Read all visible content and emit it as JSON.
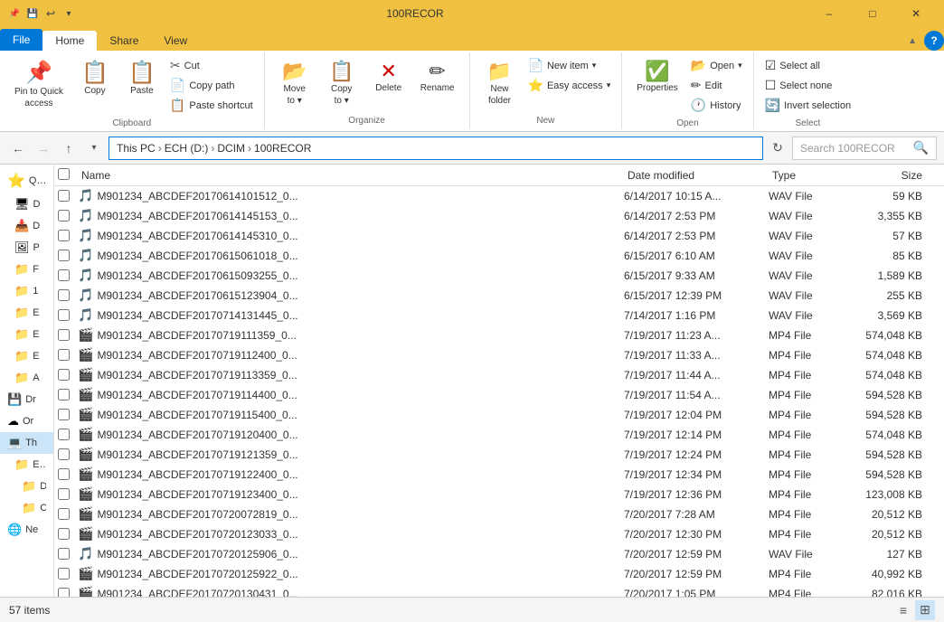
{
  "titleBar": {
    "title": "100RECOR",
    "pinIcon": "📌",
    "quickAccessIcons": [
      "💾",
      "↩️",
      "⚡"
    ],
    "minimizeLabel": "–",
    "maximizeLabel": "□",
    "closeLabel": "✕"
  },
  "ribbon": {
    "tabs": [
      "File",
      "Home",
      "Share",
      "View"
    ],
    "activeTab": "Home",
    "sections": {
      "clipboard": {
        "label": "Clipboard",
        "pinBtn": "📌",
        "pinLabel": "Pin to Quick\naccess",
        "copyBtn": "Copy",
        "pasteBtn": "Paste",
        "cutLabel": "Cut",
        "copyPathLabel": "Copy path",
        "pasteShortcutLabel": "Paste shortcut"
      },
      "organize": {
        "label": "Organize",
        "moveToLabel": "Move\nto",
        "copyToLabel": "Copy\nto",
        "deleteLabel": "Delete",
        "renameLabel": "Rename"
      },
      "new": {
        "label": "New",
        "newFolderLabel": "New\nfolder",
        "newItemLabel": "New item",
        "easyAccessLabel": "Easy access"
      },
      "open": {
        "label": "Open",
        "openLabel": "Open",
        "editLabel": "Edit",
        "historyLabel": "History",
        "propertiesLabel": "Properties"
      },
      "select": {
        "label": "Select",
        "selectAllLabel": "Select all",
        "selectNoneLabel": "Select none",
        "invertLabel": "Invert selection"
      }
    }
  },
  "addressBar": {
    "backDisabled": false,
    "forwardDisabled": true,
    "upLabel": "↑",
    "path": [
      "This PC",
      "ECH (D:)",
      "DCIM",
      "100RECOR"
    ],
    "searchPlaceholder": "Search 100RECOR",
    "refreshLabel": "↻"
  },
  "sidebar": {
    "items": [
      {
        "id": "quick-access",
        "icon": "⭐",
        "label": "Qu...",
        "selected": false
      },
      {
        "id": "desktop",
        "icon": "🖥",
        "label": "D",
        "selected": false
      },
      {
        "id": "downloads",
        "icon": "📥",
        "label": "D",
        "selected": false
      },
      {
        "id": "pictures",
        "icon": "🖼",
        "label": "P",
        "selected": false
      },
      {
        "id": "folder1",
        "icon": "📁",
        "label": "F",
        "selected": false
      },
      {
        "id": "folder2",
        "icon": "📁",
        "label": "1",
        "selected": false
      },
      {
        "id": "folder3",
        "icon": "📁",
        "label": "E",
        "selected": false
      },
      {
        "id": "folder4",
        "icon": "📁",
        "label": "E",
        "selected": false
      },
      {
        "id": "folder5",
        "icon": "📁",
        "label": "E",
        "selected": false
      },
      {
        "id": "folder6",
        "icon": "📁",
        "label": "A",
        "selected": false
      },
      {
        "id": "drives",
        "icon": "💾",
        "label": "Dr",
        "selected": false
      },
      {
        "id": "onedrive",
        "icon": "☁",
        "label": "Or",
        "selected": false
      },
      {
        "id": "thispc",
        "icon": "💻",
        "label": "Th",
        "selected": true
      },
      {
        "id": "ech",
        "icon": "📁",
        "label": "EC",
        "selected": false
      },
      {
        "id": "local1",
        "icon": "📁",
        "label": "D",
        "selected": false
      },
      {
        "id": "local2",
        "icon": "📁",
        "label": "C",
        "selected": false
      },
      {
        "id": "network",
        "icon": "🌐",
        "label": "Ne",
        "selected": false
      }
    ]
  },
  "fileList": {
    "headers": {
      "name": "Name",
      "dateModified": "Date modified",
      "type": "Type",
      "size": "Size"
    },
    "files": [
      {
        "name": "M901234_ABCDEF20170614101512_0...",
        "date": "6/14/2017 10:15 A...",
        "type": "WAV File",
        "size": "59 KB",
        "icon": "🎵"
      },
      {
        "name": "M901234_ABCDEF20170614145153_0...",
        "date": "6/14/2017 2:53 PM",
        "type": "WAV File",
        "size": "3,355 KB",
        "icon": "🎵"
      },
      {
        "name": "M901234_ABCDEF20170614145310_0...",
        "date": "6/14/2017 2:53 PM",
        "type": "WAV File",
        "size": "57 KB",
        "icon": "🎵"
      },
      {
        "name": "M901234_ABCDEF20170615061018_0...",
        "date": "6/15/2017 6:10 AM",
        "type": "WAV File",
        "size": "85 KB",
        "icon": "🎵"
      },
      {
        "name": "M901234_ABCDEF20170615093255_0...",
        "date": "6/15/2017 9:33 AM",
        "type": "WAV File",
        "size": "1,589 KB",
        "icon": "🎵"
      },
      {
        "name": "M901234_ABCDEF20170615123904_0...",
        "date": "6/15/2017 12:39 PM",
        "type": "WAV File",
        "size": "255 KB",
        "icon": "🎵"
      },
      {
        "name": "M901234_ABCDEF20170714131445_0...",
        "date": "7/14/2017 1:16 PM",
        "type": "WAV File",
        "size": "3,569 KB",
        "icon": "🎵"
      },
      {
        "name": "M901234_ABCDEF20170719111359_0...",
        "date": "7/19/2017 11:23 A...",
        "type": "MP4 File",
        "size": "574,048 KB",
        "icon": "🎬"
      },
      {
        "name": "M901234_ABCDEF20170719112400_0...",
        "date": "7/19/2017 11:33 A...",
        "type": "MP4 File",
        "size": "574,048 KB",
        "icon": "🎬"
      },
      {
        "name": "M901234_ABCDEF20170719113359_0...",
        "date": "7/19/2017 11:44 A...",
        "type": "MP4 File",
        "size": "574,048 KB",
        "icon": "🎬"
      },
      {
        "name": "M901234_ABCDEF20170719114400_0...",
        "date": "7/19/2017 11:54 A...",
        "type": "MP4 File",
        "size": "594,528 KB",
        "icon": "🎬"
      },
      {
        "name": "M901234_ABCDEF20170719115400_0...",
        "date": "7/19/2017 12:04 PM",
        "type": "MP4 File",
        "size": "594,528 KB",
        "icon": "🎬"
      },
      {
        "name": "M901234_ABCDEF20170719120400_0...",
        "date": "7/19/2017 12:14 PM",
        "type": "MP4 File",
        "size": "574,048 KB",
        "icon": "🎬"
      },
      {
        "name": "M901234_ABCDEF20170719121359_0...",
        "date": "7/19/2017 12:24 PM",
        "type": "MP4 File",
        "size": "594,528 KB",
        "icon": "🎬"
      },
      {
        "name": "M901234_ABCDEF20170719122400_0...",
        "date": "7/19/2017 12:34 PM",
        "type": "MP4 File",
        "size": "594,528 KB",
        "icon": "🎬"
      },
      {
        "name": "M901234_ABCDEF20170719123400_0...",
        "date": "7/19/2017 12:36 PM",
        "type": "MP4 File",
        "size": "123,008 KB",
        "icon": "🎬"
      },
      {
        "name": "M901234_ABCDEF20170720072819_0...",
        "date": "7/20/2017 7:28 AM",
        "type": "MP4 File",
        "size": "20,512 KB",
        "icon": "🎬"
      },
      {
        "name": "M901234_ABCDEF20170720123033_0...",
        "date": "7/20/2017 12:30 PM",
        "type": "MP4 File",
        "size": "20,512 KB",
        "icon": "🎬"
      },
      {
        "name": "M901234_ABCDEF20170720125906_0...",
        "date": "7/20/2017 12:59 PM",
        "type": "WAV File",
        "size": "127 KB",
        "icon": "🎵"
      },
      {
        "name": "M901234_ABCDEF20170720125922_0...",
        "date": "7/20/2017 12:59 PM",
        "type": "MP4 File",
        "size": "40,992 KB",
        "icon": "🎬"
      },
      {
        "name": "M901234_ABCDEF20170720130431_0...",
        "date": "7/20/2017 1:05 PM",
        "type": "MP4 File",
        "size": "82,016 KB",
        "icon": "🎬"
      }
    ]
  },
  "statusBar": {
    "itemCount": "57 items",
    "viewDetails": "details-icon",
    "viewLarge": "large-icon"
  }
}
